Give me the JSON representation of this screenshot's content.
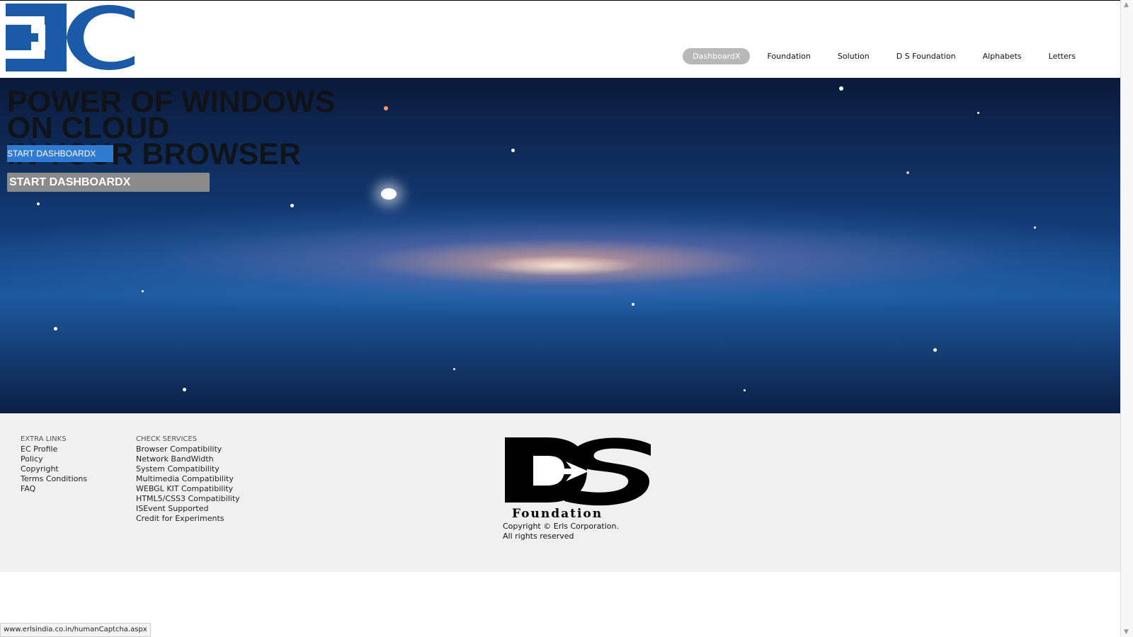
{
  "header": {
    "logo_text": "EC",
    "nav": [
      {
        "label": "DashboardX",
        "active": true
      },
      {
        "label": "Foundation"
      },
      {
        "label": "Solution"
      },
      {
        "label": "D S Foundation"
      },
      {
        "label": "Alphabets"
      },
      {
        "label": "Letters"
      }
    ]
  },
  "hero": {
    "title_lines": [
      "POWER OF WINDOWS",
      "ON CLOUD",
      "IN YOUR BROWSER"
    ],
    "button_small": "START DASHBOARDX",
    "button_big": "START DASHBOARDX"
  },
  "footer": {
    "extra_links": {
      "title": "EXTRA LINKS",
      "items": [
        "EC Profile",
        "Policy",
        "Copyright",
        "Terms Conditions",
        "FAQ"
      ]
    },
    "check_services": {
      "title": "CHECK SERVICES",
      "items": [
        "Browser Compatibility",
        "Network BandWidth",
        "System Compatibility",
        "Multimedia Compatibility",
        "WEBGL KIT Compatibility",
        "HTML5/CSS3 Compatibility",
        "ISEvent Supported",
        "Credit for Experiments"
      ]
    },
    "ds_logo_text": "Foundation",
    "copyright_line1": "Copyright © Erls Corporation.",
    "copyright_line2": "All rights reserved"
  },
  "status_bar": {
    "url": "www.erlsindia.co.in/humanCaptcha.aspx"
  },
  "colors": {
    "logo_blue": "#1a5aa6",
    "button_blue": "#2f7bd1",
    "nav_active": "#b8b8b8"
  }
}
